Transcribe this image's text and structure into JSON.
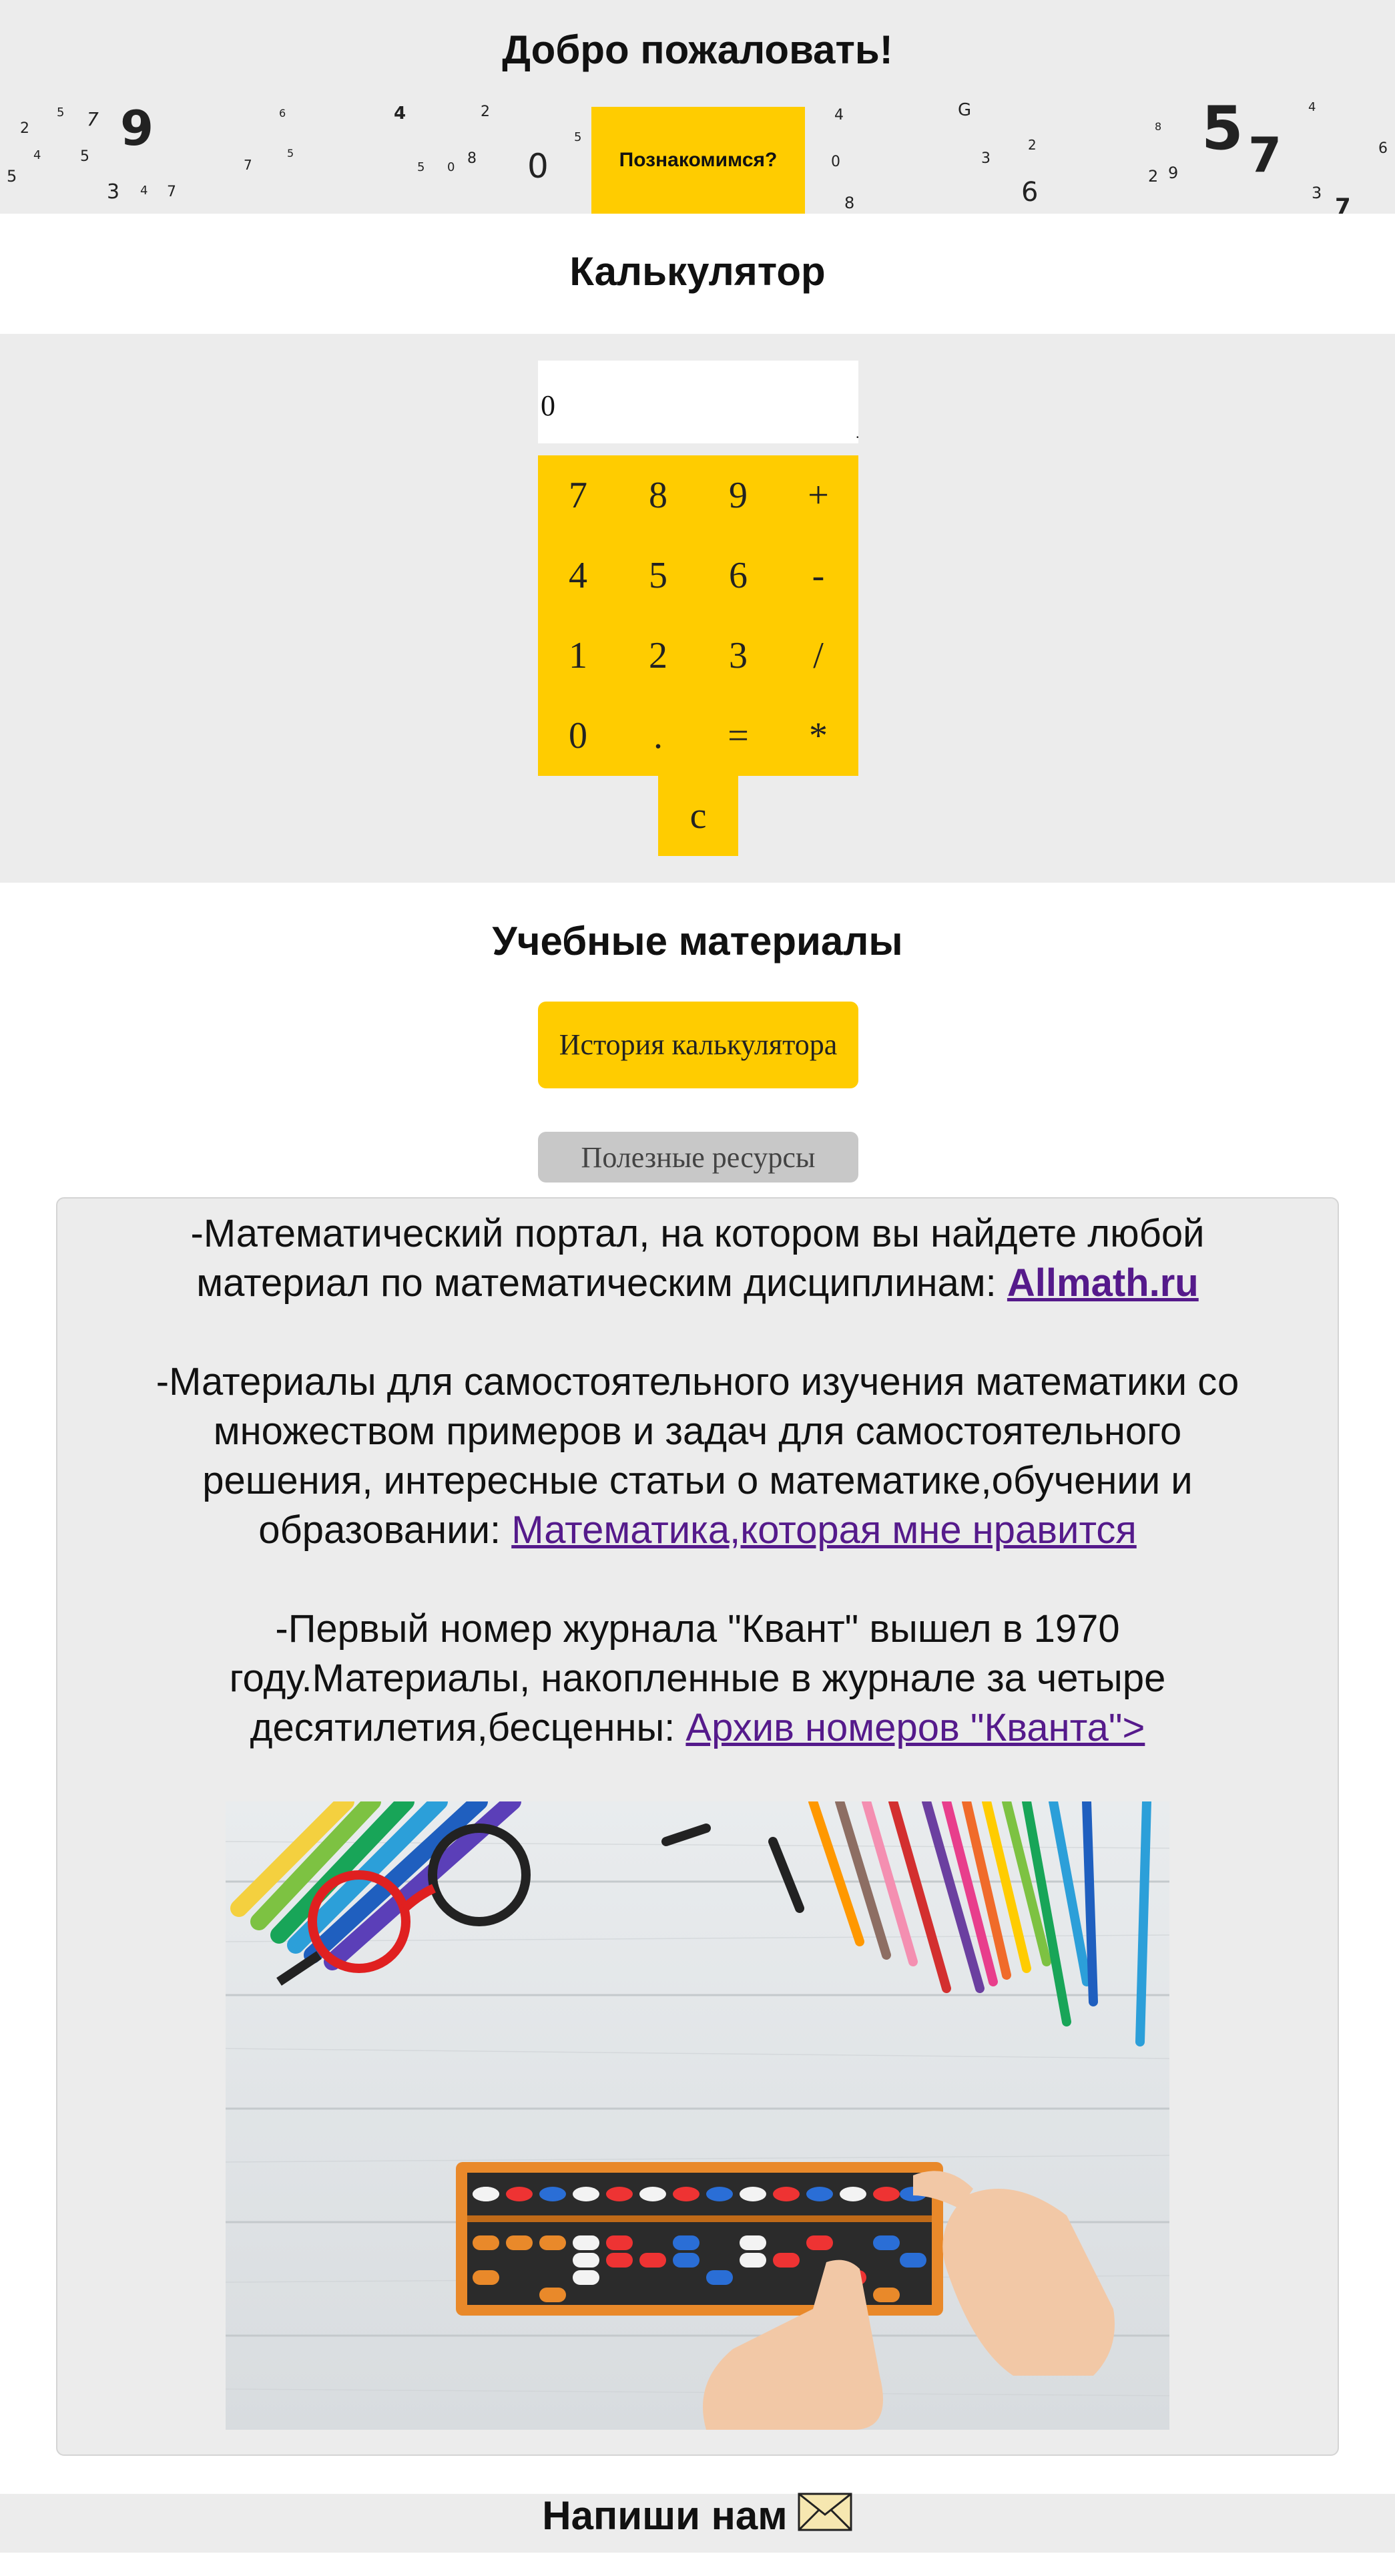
{
  "header": {
    "title": "Добро пожаловать!",
    "cta_label": "Познакомимся?"
  },
  "calculator": {
    "title": "Калькулятор",
    "display_value": "0",
    "keys": {
      "k7": "7",
      "k8": "8",
      "k9": "9",
      "plus": "+",
      "k4": "4",
      "k5": "5",
      "k6": "6",
      "minus": "-",
      "k1": "1",
      "k2": "2",
      "k3": "3",
      "divide": "/",
      "k0": "0",
      "dot": ".",
      "equals": "=",
      "multiply": "*",
      "clear": "c"
    },
    "accent_color": "#ffcc00"
  },
  "materials": {
    "title": "Учебные материалы",
    "history_button": "История калькулятора",
    "resources_button": "Полезные ресурсы",
    "items": [
      {
        "text_line1": "-Математический портал, на котором вы найдете любой",
        "text_line2": "материал по математическим дисциплинам: ",
        "link": "Allmath.ru"
      },
      {
        "text_line1": "-Материалы для самостоятельного изучения математики со",
        "text_line2": "множеством примеров и задач для самостоятельного",
        "text_line3": "решения, интересные статьи о математике,обучении и",
        "text_line4": "образовании: ",
        "link": "Математика,которая мне нравится"
      },
      {
        "text_line1": "-Первый номер журнала \"Квант\" вышел в 1970",
        "text_line2": "году.Материалы, накопленные в журнале за четыре",
        "text_line3": "десятилетия,бесценны: ",
        "link": "Архив номеров \"Кванта\">"
      }
    ],
    "image": "abacus-with-colored-pencils-photo"
  },
  "footer": {
    "label": "Напиши нам",
    "icon": "envelope-icon"
  }
}
